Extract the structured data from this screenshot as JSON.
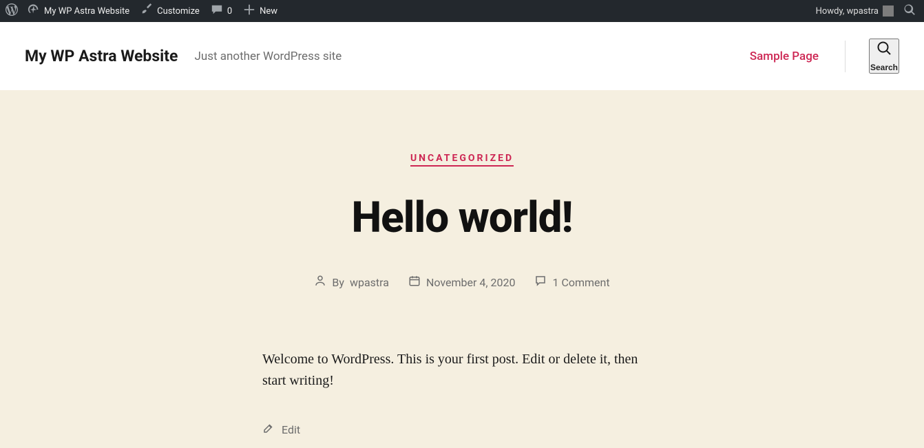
{
  "adminbar": {
    "site_name": "My WP Astra Website",
    "customize": "Customize",
    "comments_count": "0",
    "new": "New",
    "howdy": "Howdy, wpastra"
  },
  "header": {
    "site_title": "My WP Astra Website",
    "tagline": "Just another WordPress site",
    "nav": {
      "sample_page": "Sample Page"
    },
    "search_label": "Search"
  },
  "post": {
    "category": "Uncategorized",
    "title": "Hello world!",
    "by_label": "By ",
    "author": "wpastra",
    "date": "November 4, 2020",
    "comments": "1 Comment",
    "body": "Welcome to WordPress. This is your first post. Edit or delete it, then start writing!",
    "edit": "Edit"
  }
}
